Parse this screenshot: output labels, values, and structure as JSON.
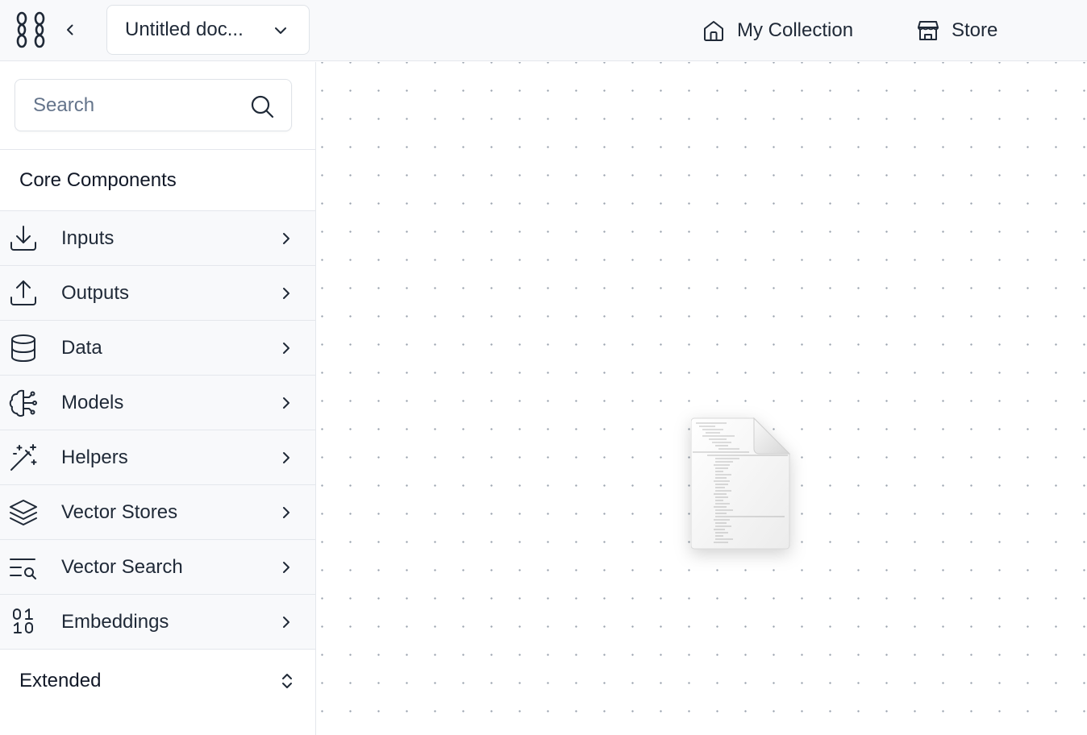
{
  "header": {
    "document_title": "Untitled doc...",
    "nav": {
      "collection_label": "My Collection",
      "store_label": "Store"
    }
  },
  "sidebar": {
    "search": {
      "placeholder": "Search",
      "value": ""
    },
    "core_section_title": "Core Components",
    "categories": [
      {
        "label": "Inputs",
        "icon": "download-icon"
      },
      {
        "label": "Outputs",
        "icon": "upload-icon"
      },
      {
        "label": "Data",
        "icon": "database-icon"
      },
      {
        "label": "Models",
        "icon": "brain-circuit-icon"
      },
      {
        "label": "Helpers",
        "icon": "magic-wand-icon"
      },
      {
        "label": "Vector Stores",
        "icon": "layers-icon"
      },
      {
        "label": "Vector Search",
        "icon": "text-search-icon"
      },
      {
        "label": "Embeddings",
        "icon": "binary-icon"
      }
    ],
    "extended_section_title": "Extended"
  },
  "canvas": {
    "dragged_item_icon": "document-file-icon"
  },
  "colors": {
    "header_bg": "#f8f9fb",
    "row_bg": "#f8f9fb",
    "border": "#e4e7ec",
    "text": "#1f2937",
    "placeholder": "#64748b",
    "grid_dot": "#9aa3ae"
  }
}
